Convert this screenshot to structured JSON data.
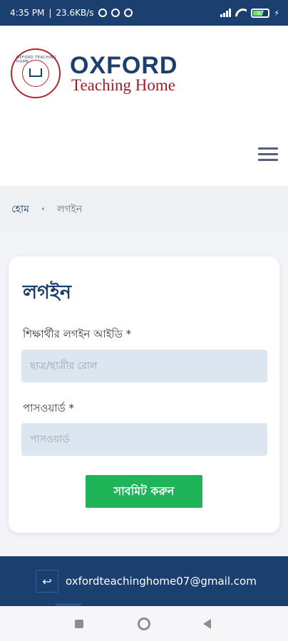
{
  "status_bar": {
    "time": "4:35 PM",
    "speed": "23.6KB/s",
    "battery": "57"
  },
  "brand": {
    "name_line1": "OXFORD",
    "name_line2": "Teaching Home",
    "seal_text": "OXFORD TEACHING HOME"
  },
  "breadcrumb": {
    "home": "হোম",
    "separator": "•",
    "current": "লগইন"
  },
  "login": {
    "title": "লগইন",
    "id_label": "শিক্ষার্থীর লগইন আইডি *",
    "id_placeholder": "ছাত্র/ছাত্রীর রোল",
    "id_value": "",
    "password_label": "পাসওয়ার্ড *",
    "password_placeholder": "পাসওয়ার্ড",
    "password_value": "",
    "submit_label": "সাবমিট করুন"
  },
  "footer": {
    "email": "oxfordteachinghome07@gmail.com",
    "email_icon": "reply-arrow-icon"
  },
  "colors": {
    "primary": "#1b3f6e",
    "brand_red": "#a11b24",
    "submit_green": "#1fb457",
    "input_bg": "#dce6f0"
  }
}
